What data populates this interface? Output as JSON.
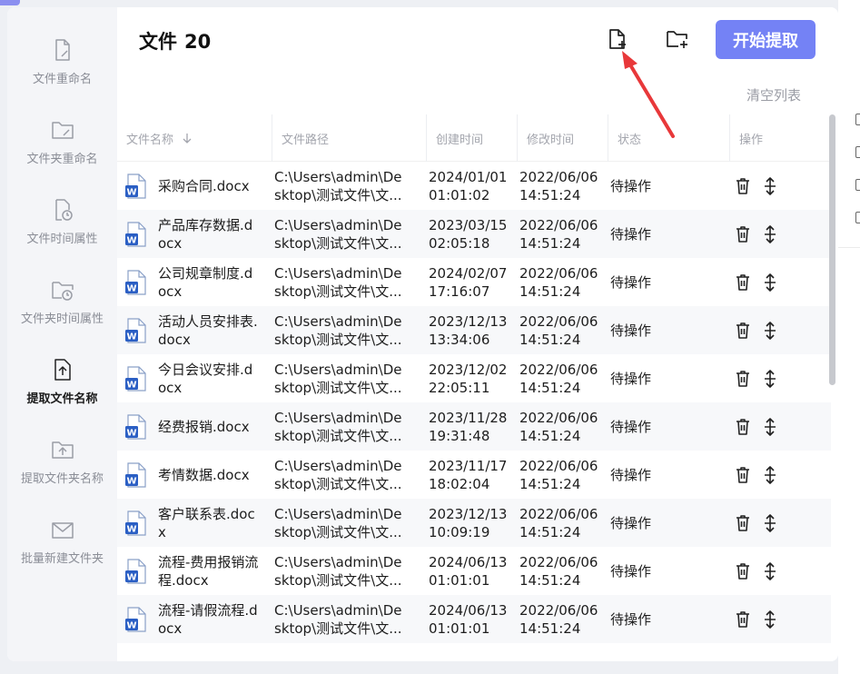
{
  "window": {
    "accent": "#7482f5",
    "arrow_color": "#e8383a"
  },
  "sidebar": {
    "items": [
      {
        "label": "文件重命名",
        "icon": "file-edit-icon",
        "active": false
      },
      {
        "label": "文件夹重命名",
        "icon": "folder-edit-icon",
        "active": false
      },
      {
        "label": "文件时间属性",
        "icon": "file-clock-icon",
        "active": false
      },
      {
        "label": "文件夹时间属性",
        "icon": "folder-clock-icon",
        "active": false
      },
      {
        "label": "提取文件名称",
        "icon": "file-upload-icon",
        "active": true
      },
      {
        "label": "提取文件夹名称",
        "icon": "folder-upload-icon",
        "active": false
      },
      {
        "label": "批量新建文件夹",
        "icon": "mail-icon",
        "active": false
      }
    ]
  },
  "header": {
    "title_label": "文件",
    "title_count": "20",
    "add_file_icon": "add-file-icon",
    "add_folder_icon": "add-folder-icon",
    "start_button": "开始提取",
    "clear_list": "清空列表"
  },
  "table": {
    "columns": [
      "文件名称",
      "文件路径",
      "创建时间",
      "修改时间",
      "状态",
      "操作"
    ],
    "rows": [
      {
        "name": "采购合同.docx",
        "path": "C:\\Users\\admin\\Desktop\\测试文件\\文...",
        "created": "2024/01/01 01:01:02",
        "modified": "2022/06/06 14:51:24",
        "status": "待操作"
      },
      {
        "name": "产品库存数据.docx",
        "path": "C:\\Users\\admin\\Desktop\\测试文件\\文...",
        "created": "2023/03/15 02:05:18",
        "modified": "2022/06/06 14:51:24",
        "status": "待操作"
      },
      {
        "name": "公司规章制度.docx",
        "path": "C:\\Users\\admin\\Desktop\\测试文件\\文...",
        "created": "2024/02/07 17:16:07",
        "modified": "2022/06/06 14:51:24",
        "status": "待操作"
      },
      {
        "name": "活动人员安排表.docx",
        "path": "C:\\Users\\admin\\Desktop\\测试文件\\文...",
        "created": "2023/12/13 13:34:06",
        "modified": "2022/06/06 14:51:24",
        "status": "待操作"
      },
      {
        "name": "今日会议安排.docx",
        "path": "C:\\Users\\admin\\Desktop\\测试文件\\文...",
        "created": "2023/12/02 22:05:11",
        "modified": "2022/06/06 14:51:24",
        "status": "待操作"
      },
      {
        "name": "经费报销.docx",
        "path": "C:\\Users\\admin\\Desktop\\测试文件\\文...",
        "created": "2023/11/28 19:31:48",
        "modified": "2022/06/06 14:51:24",
        "status": "待操作"
      },
      {
        "name": "考情数据.docx",
        "path": "C:\\Users\\admin\\Desktop\\测试文件\\文...",
        "created": "2023/11/17 18:02:04",
        "modified": "2022/06/06 14:51:24",
        "status": "待操作"
      },
      {
        "name": "客户联系表.docx",
        "path": "C:\\Users\\admin\\Desktop\\测试文件\\文...",
        "created": "2023/12/13 10:09:19",
        "modified": "2022/06/06 14:51:24",
        "status": "待操作"
      },
      {
        "name": "流程-费用报销流程.docx",
        "path": "C:\\Users\\admin\\Desktop\\测试文件\\文...",
        "created": "2024/06/13 01:01:01",
        "modified": "2022/06/06 14:51:24",
        "status": "待操作"
      },
      {
        "name": "流程-请假流程.docx",
        "path": "C:\\Users\\admin\\Desktop\\测试文件\\文...",
        "created": "2024/06/13 01:01:01",
        "modified": "2022/06/06 14:51:24",
        "status": "待操作"
      }
    ]
  }
}
